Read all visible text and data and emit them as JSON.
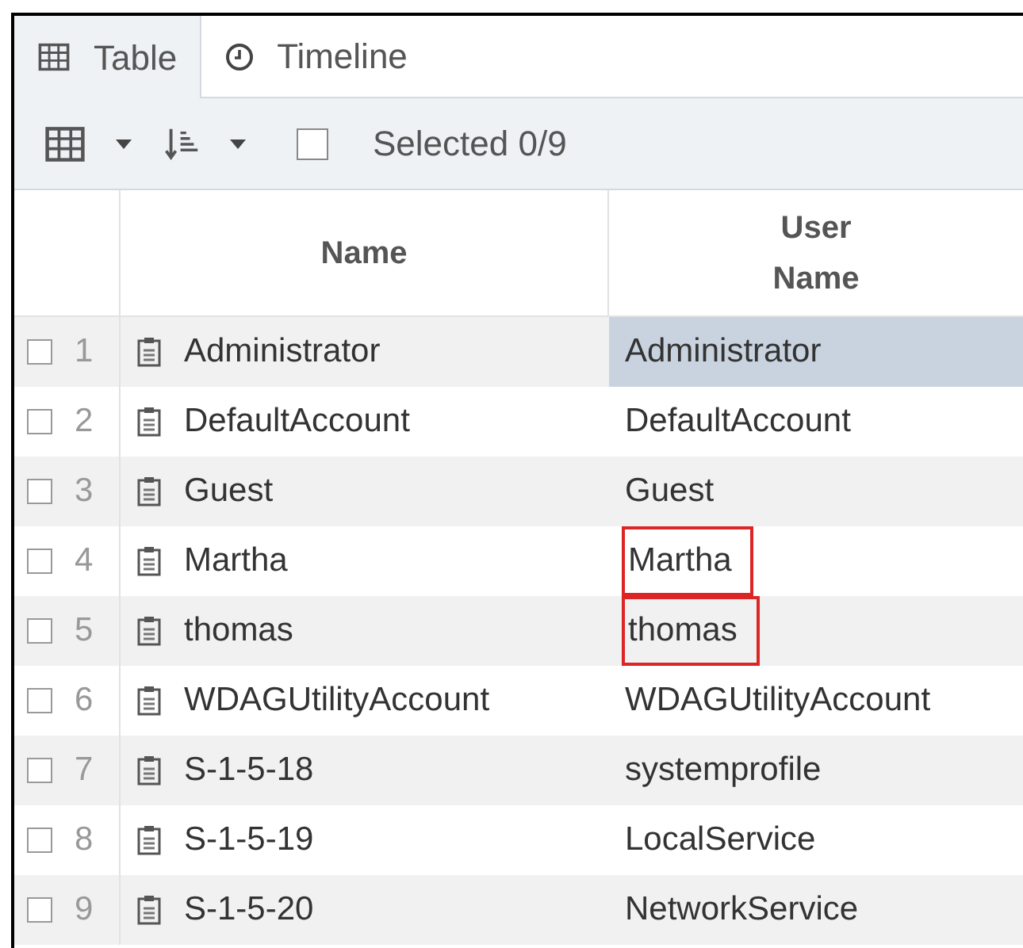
{
  "tabs": [
    {
      "label": "Table",
      "selected": true
    },
    {
      "label": "Timeline",
      "selected": false
    }
  ],
  "toolbar": {
    "select_all_checked": false,
    "selected_count": "Selected 0/9"
  },
  "table": {
    "columns": [
      "Name",
      "User Name"
    ],
    "rows": [
      {
        "number": "1",
        "checked": false,
        "name": "Administrator",
        "user_name": "Administrator",
        "selected": true,
        "outlined": false
      },
      {
        "number": "2",
        "checked": false,
        "name": "DefaultAccount",
        "user_name": "DefaultAccount",
        "selected": false,
        "outlined": false
      },
      {
        "number": "3",
        "checked": false,
        "name": "Guest",
        "user_name": "Guest",
        "selected": false,
        "outlined": false
      },
      {
        "number": "4",
        "checked": false,
        "name": "Martha",
        "user_name": "Martha",
        "selected": false,
        "outlined": true
      },
      {
        "number": "5",
        "checked": false,
        "name": "thomas",
        "user_name": "thomas",
        "selected": false,
        "outlined": true
      },
      {
        "number": "6",
        "checked": false,
        "name": "WDAGUtilityAccount",
        "user_name": "WDAGUtilityAccount",
        "selected": false,
        "outlined": false
      },
      {
        "number": "7",
        "checked": false,
        "name": "S-1-5-18",
        "user_name": "systemprofile",
        "selected": false,
        "outlined": false
      },
      {
        "number": "8",
        "checked": false,
        "name": "S-1-5-19",
        "user_name": "LocalService",
        "selected": false,
        "outlined": false
      },
      {
        "number": "9",
        "checked": false,
        "name": "S-1-5-20",
        "user_name": "NetworkService",
        "selected": false,
        "outlined": false
      }
    ]
  }
}
